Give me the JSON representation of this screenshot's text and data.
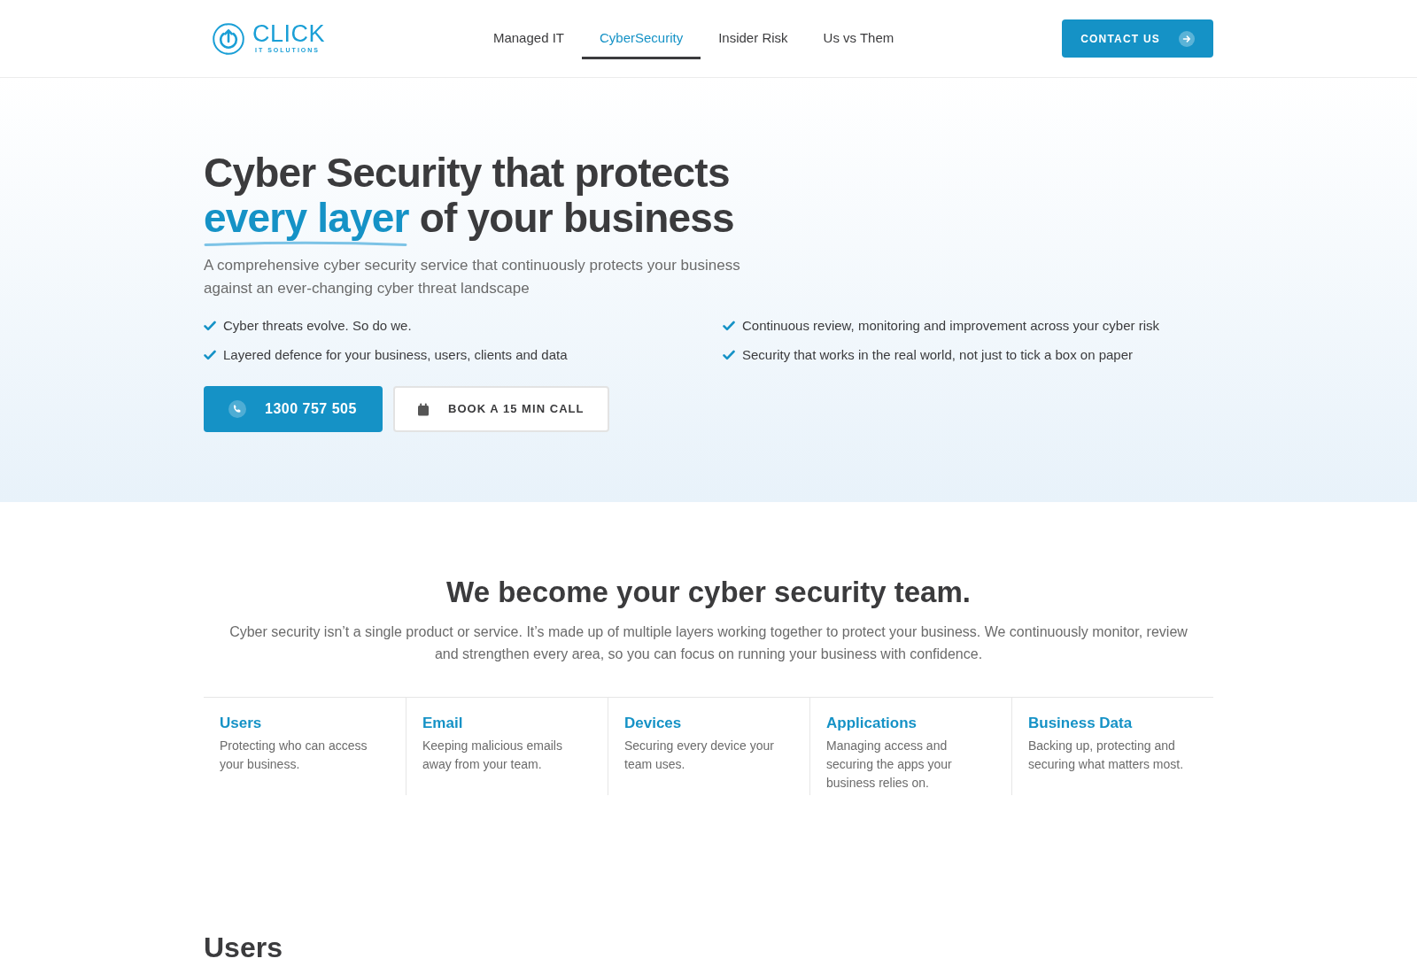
{
  "header": {
    "logo": {
      "name": "CLICK",
      "tagline": "IT SOLUTIONS"
    },
    "nav": [
      {
        "label": "Managed IT",
        "selected": false
      },
      {
        "label": "CyberSecurity",
        "selected": true
      },
      {
        "label": "Insider Risk",
        "selected": false
      },
      {
        "label": "Us vs Them",
        "selected": false
      }
    ],
    "contact_button": "CONTACT US"
  },
  "hero": {
    "heading": {
      "lead": "Cyber Security that protects",
      "highlight": "every layer",
      "rest": "of your business"
    },
    "subtitle": "A comprehensive cyber security service that continuously protects your business against an ever-changing cyber threat landscape",
    "checklist": [
      "Cyber threats evolve. So do we.",
      "Continuous review, monitoring and improvement across your cyber risk",
      "Layered defence for your business, users, clients and data",
      "Security that works in the real world, not just to tick a box on paper"
    ],
    "buttons": [
      {
        "kind": "phone",
        "label": "1300 757 505"
      },
      {
        "kind": "booking",
        "label": "BOOK A 15 MIN CALL"
      }
    ]
  },
  "intro": {
    "heading": "We become your cyber security team.",
    "text": "Cyber security isn’t a single product or service. It’s made up of multiple layers working together to protect your business. We continuously monitor, review and strengthen every area, so you can focus on running your business with confidence."
  },
  "layers": [
    {
      "title": "Users",
      "description": "Protecting who can access your business."
    },
    {
      "title": "Email",
      "description": "Keeping malicious emails away from your team."
    },
    {
      "title": "Devices",
      "description": "Securing every device your team uses."
    },
    {
      "title": "Applications",
      "description": "Managing access and securing the apps your business relies on."
    },
    {
      "title": "Business Data",
      "description": "Backing up, protecting and securing what matters most."
    }
  ],
  "next_section": {
    "heading": "Users"
  }
}
